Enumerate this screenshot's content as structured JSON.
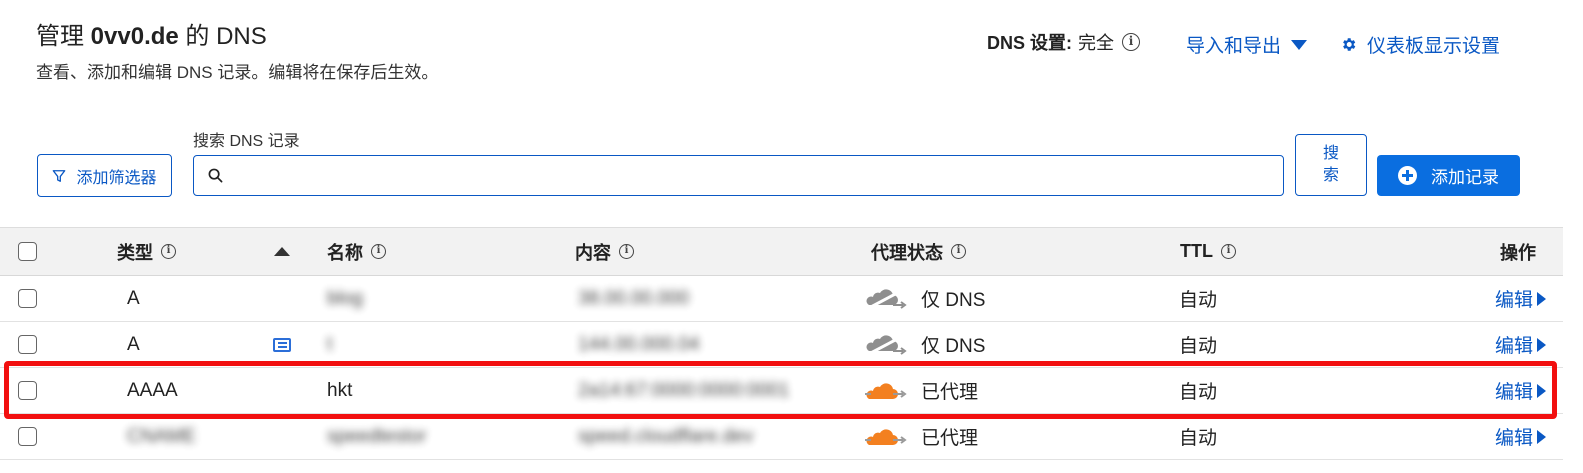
{
  "header": {
    "title_prefix": "管理",
    "domain": "0vv0.de",
    "title_suffix": "的 DNS",
    "subtitle": "查看、添加和编辑 DNS 记录。编辑将在保存后生效。",
    "dns_setting_label": "DNS 设置:",
    "dns_setting_value": "完全",
    "import_export_label": "导入和导出",
    "dashboard_settings_label": "仪表板显示设置"
  },
  "toolbar": {
    "add_filter_label": "添加筛选器",
    "search_label": "搜索 DNS 记录",
    "search_value": "",
    "search_button_label": "搜索",
    "add_record_label": "添加记录"
  },
  "table": {
    "columns": {
      "type": "类型",
      "name": "名称",
      "content": "内容",
      "proxy": "代理状态",
      "ttl": "TTL",
      "actions": "操作"
    },
    "rows": [
      {
        "type": "A",
        "name": "blog",
        "content": "38.00.00.000",
        "proxy": "仅 DNS",
        "proxied": false,
        "ttl": "自动",
        "action": "编辑"
      },
      {
        "type": "A",
        "name": "t",
        "content": "144.00.000.04",
        "proxy": "仅 DNS",
        "proxied": false,
        "ttl": "自动",
        "action": "编辑",
        "has_comment": true
      },
      {
        "type": "AAAA",
        "name": "hkt",
        "content": "2a14:67:0000:0000:0001",
        "proxy": "已代理",
        "proxied": true,
        "ttl": "自动",
        "action": "编辑",
        "highlighted": true
      },
      {
        "type": "CNAME",
        "name": "speedtestor",
        "content": "speed.cloudflare.dev",
        "proxy": "已代理",
        "proxied": true,
        "ttl": "自动",
        "action": "编辑"
      }
    ]
  },
  "colors": {
    "link": "#0a58c4",
    "primary_button": "#0a6ee0",
    "highlight_border": "#f20f0f",
    "proxied_cloud": "#f38020",
    "dns_only_cloud": "#8a8a8a"
  }
}
